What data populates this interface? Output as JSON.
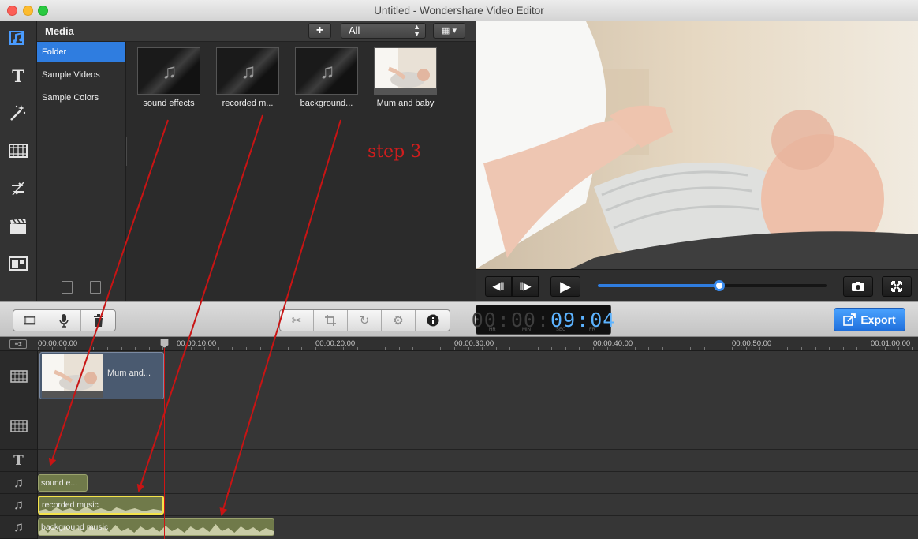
{
  "window": {
    "title": "Untitled - Wondershare Video Editor"
  },
  "toolrail": {
    "icons": [
      "music-note-icon",
      "text-icon",
      "magic-wand-icon",
      "filmstrip-icon",
      "transition-icon",
      "clapperboard-icon",
      "pip-layout-icon"
    ]
  },
  "media": {
    "header_title": "Media",
    "add_label": "+",
    "filter_value": "All",
    "folders": [
      {
        "label": "Folder",
        "active": true
      },
      {
        "label": "Sample Videos",
        "active": false
      },
      {
        "label": "Sample Colors",
        "active": false
      }
    ],
    "items": [
      {
        "label": "sound effects",
        "kind": "audio"
      },
      {
        "label": "recorded m...",
        "kind": "audio"
      },
      {
        "label": "background...",
        "kind": "audio"
      },
      {
        "label": "Mum and baby",
        "kind": "video"
      }
    ]
  },
  "player": {
    "progress_fraction": 0.53
  },
  "toolbar": {
    "timecode": {
      "hr": "00",
      "min": "00",
      "sec": "09",
      "fr": "04",
      "hr_unit": "HR",
      "min_unit": "MIN",
      "sec_unit": "SEC",
      "fr_unit": "FR"
    },
    "export_label": "Export"
  },
  "timeline": {
    "ruler_ticks": [
      "00:00:00:00",
      "00:00:10:00",
      "00:00:20:00",
      "00:00:30:00",
      "00:00:40:00",
      "00:00:50:00",
      "00:01:00:00"
    ],
    "video_clip_label": "Mum and...",
    "audio_clips": [
      {
        "label": "sound e..."
      },
      {
        "label": "recorded music",
        "selected": true
      },
      {
        "label": "background music"
      }
    ]
  },
  "annotation": {
    "step_text": "step 3",
    "color": "#c81414"
  },
  "colors": {
    "accent": "#2f7de0",
    "audio_clip": "#707a4a",
    "playhead": "#d01515"
  }
}
